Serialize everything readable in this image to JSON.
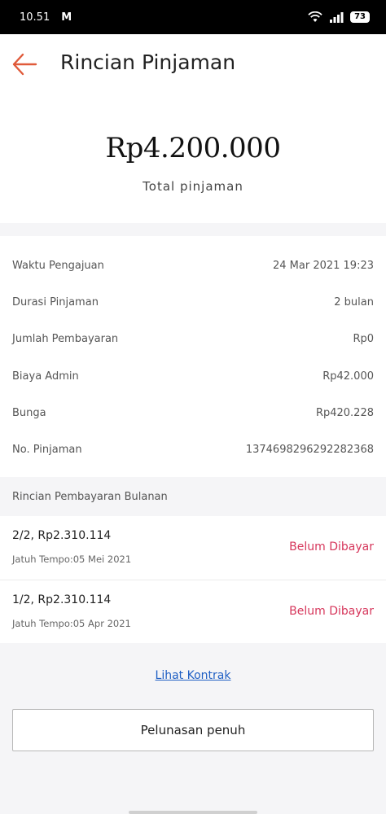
{
  "status_bar": {
    "time": "10.51",
    "notification_icon": "gmail-icon",
    "notification_glyph": "M",
    "battery": "73"
  },
  "header": {
    "title": "Rincian Pinjaman",
    "back_icon": "arrow-left-icon"
  },
  "summary": {
    "amount": "Rp4.200.000",
    "label": "Total pinjaman"
  },
  "details": [
    {
      "label": "Waktu Pengajuan",
      "value": "24 Mar 2021 19:23"
    },
    {
      "label": "Durasi Pinjaman",
      "value": "2 bulan"
    },
    {
      "label": "Jumlah Pembayaran",
      "value": "Rp0"
    },
    {
      "label": "Biaya Admin",
      "value": "Rp42.000"
    },
    {
      "label": "Bunga",
      "value": "Rp420.228"
    },
    {
      "label": "No. Pinjaman",
      "value": "1374698296292282368"
    }
  ],
  "monthly": {
    "heading": "Rincian Pembayaran Bulanan",
    "items": [
      {
        "title": "2/2, Rp2.310.114",
        "due": "Jatuh Tempo:05 Mei 2021",
        "status": "Belum Dibayar"
      },
      {
        "title": "1/2, Rp2.310.114",
        "due": "Jatuh Tempo:05 Apr 2021",
        "status": "Belum Dibayar"
      }
    ]
  },
  "actions": {
    "contract_link": "Lihat Kontrak",
    "full_payment_button": "Pelunasan penuh"
  },
  "colors": {
    "accent": "#e05a3a",
    "status_unpaid": "#d6365b",
    "link": "#1f5fc4"
  }
}
